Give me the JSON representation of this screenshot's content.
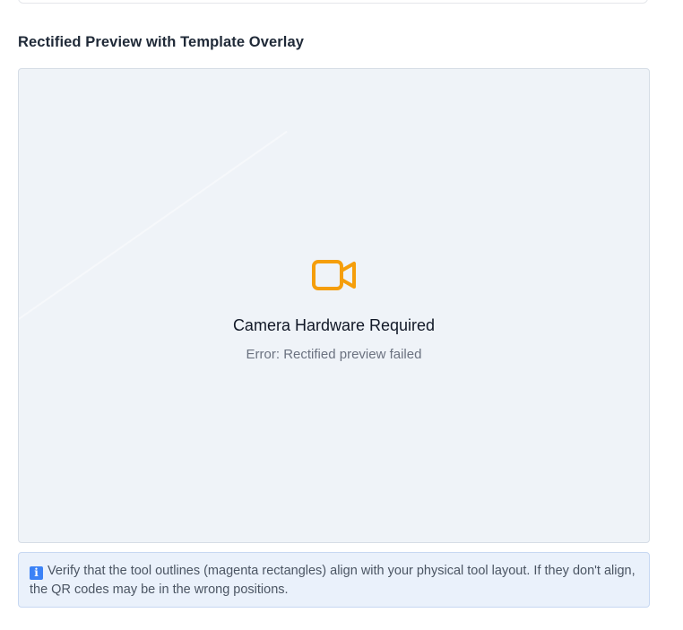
{
  "section": {
    "title": "Rectified Preview with Template Overlay"
  },
  "preview": {
    "icon": "video-camera-icon",
    "accent_color": "#f59e0b",
    "message_title": "Camera Hardware Required",
    "message_detail": "Error: Rectified preview failed"
  },
  "info": {
    "icon": "info-icon",
    "icon_glyph": "i",
    "text": "Verify that the tool outlines (magenta rectangles) align with your physical tool layout. If they don't align, the QR codes may be in the wrong positions."
  }
}
